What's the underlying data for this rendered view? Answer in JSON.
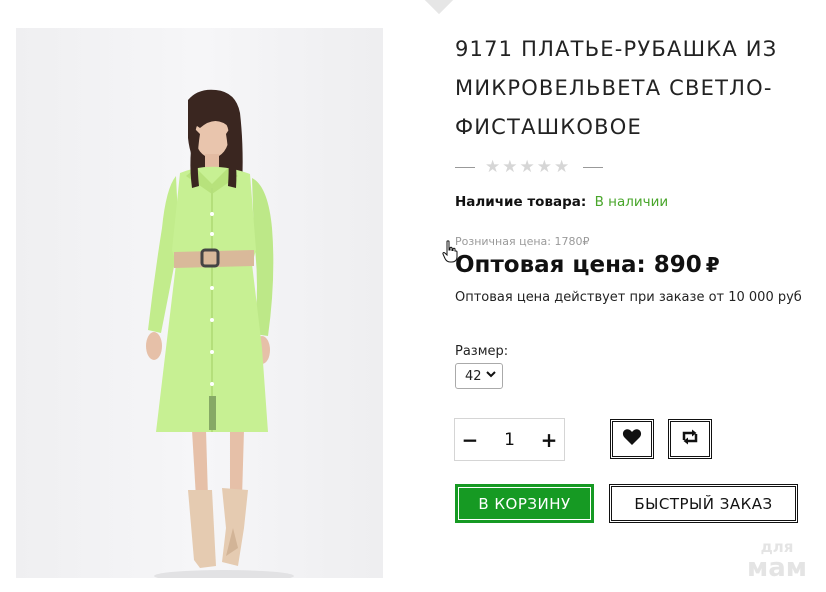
{
  "product": {
    "title": "9171 ПЛАТЬЕ-РУБАШКА ИЗ МИКРОВЕЛЬВЕТА СВЕТЛО-ФИСТАШКОВОЕ",
    "rating": {
      "stars": "★★★★★",
      "value": 0,
      "max": 5
    },
    "availability": {
      "label": "Наличие товара:",
      "value": "В наличии"
    },
    "retail_price": "Розничная цена: 1780₽",
    "wholesale_price": {
      "text": "Оптовая цена: 890",
      "currency": "₽"
    },
    "wholesale_note": "Оптовая цена действует при заказе от 10 000 руб",
    "size": {
      "label": "Размер:",
      "selected": "42"
    },
    "quantity": {
      "minus": "−",
      "value": "1",
      "plus": "+"
    },
    "buttons": {
      "cart": "В КОРЗИНУ",
      "quick_order": "БЫСТРЫЙ ЗАКАЗ"
    },
    "icons": {
      "wishlist": "heart-icon",
      "compare": "compare-arrows-icon"
    }
  },
  "colors": {
    "accent_green": "#169a23",
    "stock_green": "#49a62b",
    "dress_color": "#c7f093"
  },
  "watermark": {
    "line1": "для",
    "line2": "мам"
  }
}
